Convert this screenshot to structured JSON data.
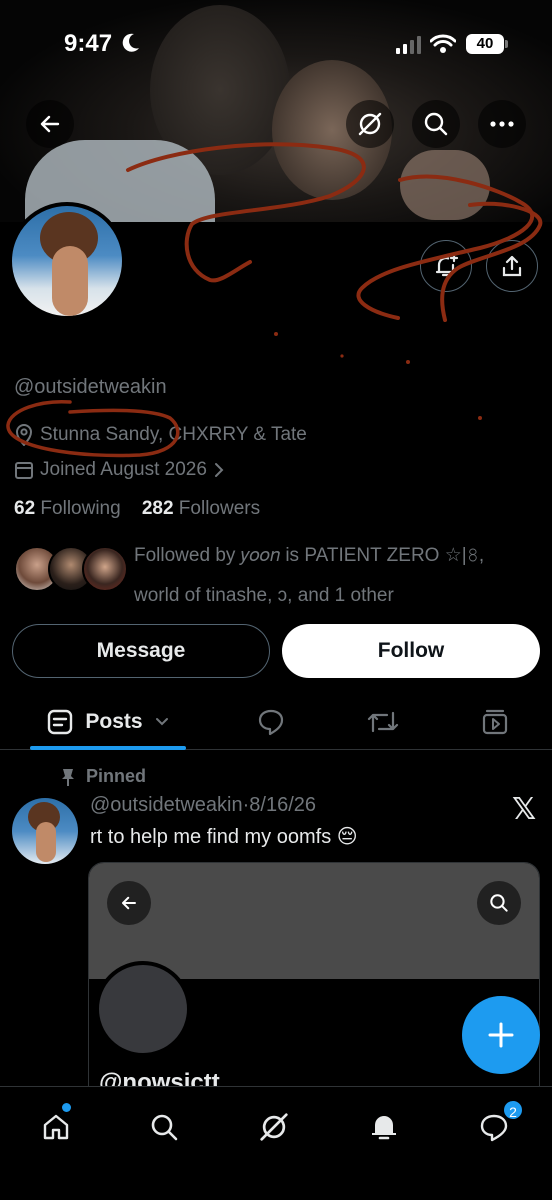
{
  "status_bar": {
    "time": "9:47",
    "battery": "40"
  },
  "profile": {
    "handle": "@outsidetweakin",
    "location": "Stunna Sandy, CHXRRY & Tate",
    "joined": "Joined August 2026",
    "following_count": "62",
    "following_label": "Following",
    "followers_count": "282",
    "followers_label": "Followers",
    "followed_by_prefix": "Followed by",
    "followed_by_name": "𝑦𝑜𝑜𝑛 is PATIENT ZERO ☆|𝟾,",
    "followed_by_rest": "world of tinashe, ↄ, and 1 other"
  },
  "actions": {
    "message_label": "Message",
    "follow_label": "Follow"
  },
  "tabs": {
    "posts_label": "Posts"
  },
  "post": {
    "pinned_label": "Pinned",
    "handle": "@outsidetweakin",
    "separator": "·",
    "date": "8/16/26",
    "text": "rt to help me find my oomfs 😔",
    "quote_handle": "@nowsictt"
  },
  "nav": {
    "messages_badge": "2"
  },
  "colors": {
    "accent": "#1d9bf0",
    "muted": "#71767b",
    "scribble": "#8b2b12"
  }
}
